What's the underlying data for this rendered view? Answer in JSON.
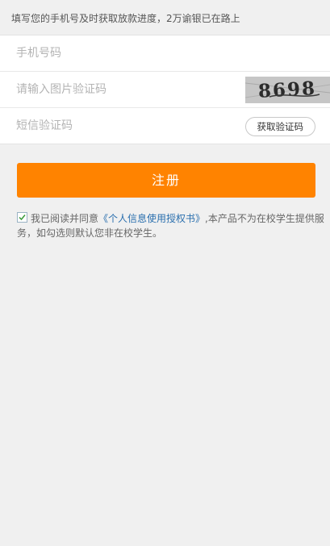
{
  "notice": "填写您的手机号及时获取放款进度，2万谕银已在路上",
  "form": {
    "phone_placeholder": "手机号码",
    "captcha_placeholder": "请输入图片验证码",
    "captcha_text": "8698",
    "sms_placeholder": "短信验证码",
    "sms_button": "获取验证码"
  },
  "register_button": "注册",
  "agreement": {
    "checked": true,
    "prefix": "我已阅读并同意",
    "link": "《个人信息使用授权书》",
    "suffix": ",本产品不为在校学生提供服务，如勾选则默认您非在校学生。"
  },
  "colors": {
    "accent": "#ff8300",
    "link": "#2a6fae",
    "background": "#f0f0f0"
  }
}
